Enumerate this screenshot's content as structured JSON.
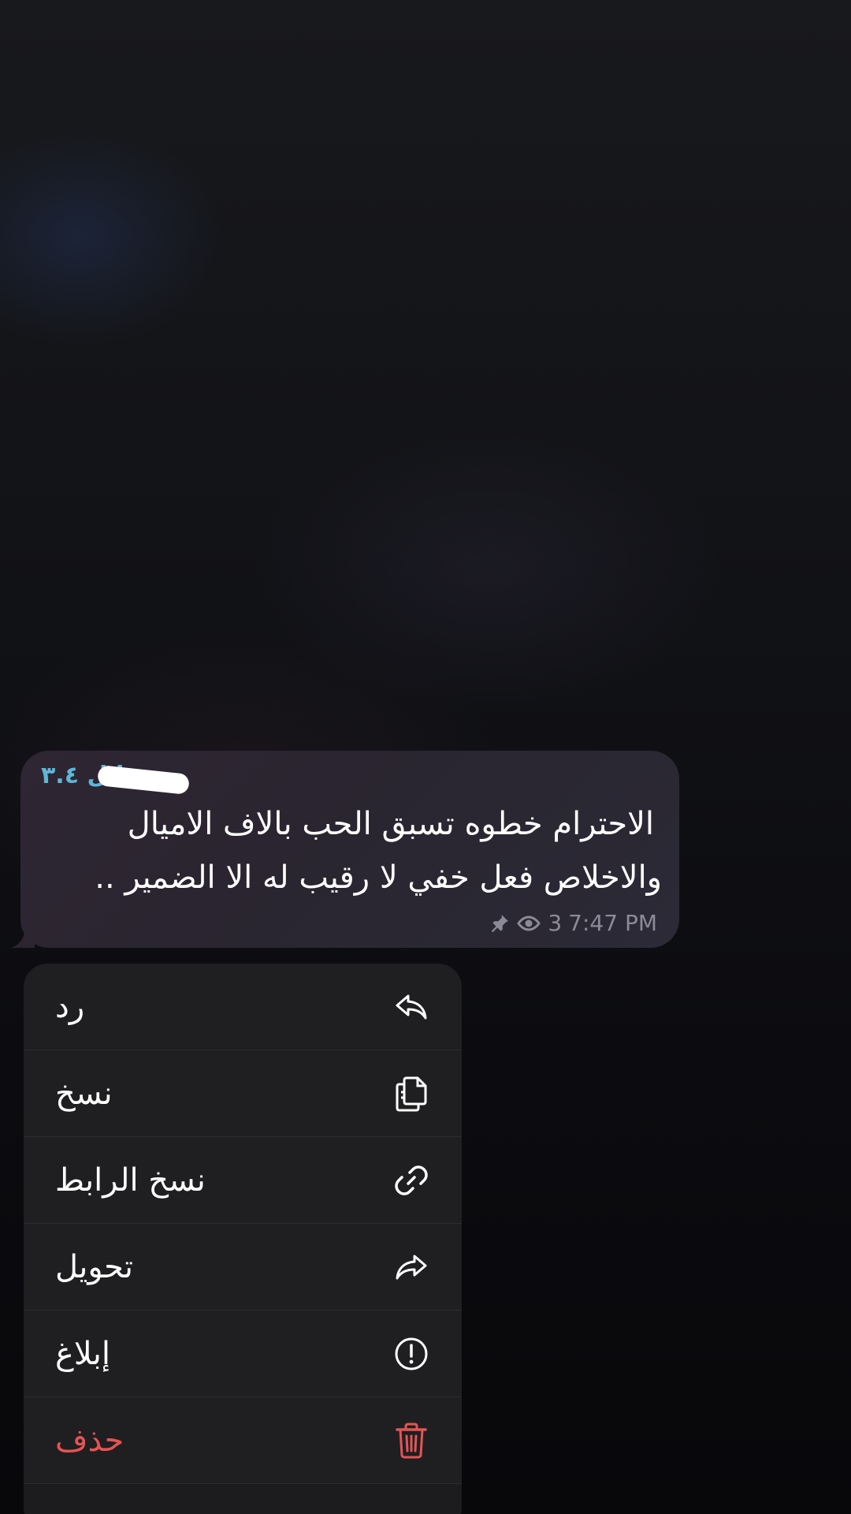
{
  "message": {
    "sender_suffix": "مَنا ل ٣.٤",
    "line1": "الاحترام خطوه تسبق الحب بالاف الاميال",
    "line2": "والاخلاص فعل خفي لا رقيب له الا الضمير ..",
    "views": "3",
    "time": "7:47 PM",
    "pinned_icon": "pin-icon",
    "views_icon": "eye-icon"
  },
  "menu": {
    "items": [
      {
        "label": "رد",
        "icon": "reply-icon"
      },
      {
        "label": "نسخ",
        "icon": "copy-icon"
      },
      {
        "label": "نسخ الرابط",
        "icon": "link-icon"
      },
      {
        "label": "تحويل",
        "icon": "forward-icon"
      },
      {
        "label": "إبلاغ",
        "icon": "report-icon"
      },
      {
        "label": "حذف",
        "icon": "trash-icon"
      }
    ]
  },
  "colors": {
    "sender": "#5fb6d6",
    "danger": "#e55454",
    "menu_bg": "#1f1f21"
  }
}
